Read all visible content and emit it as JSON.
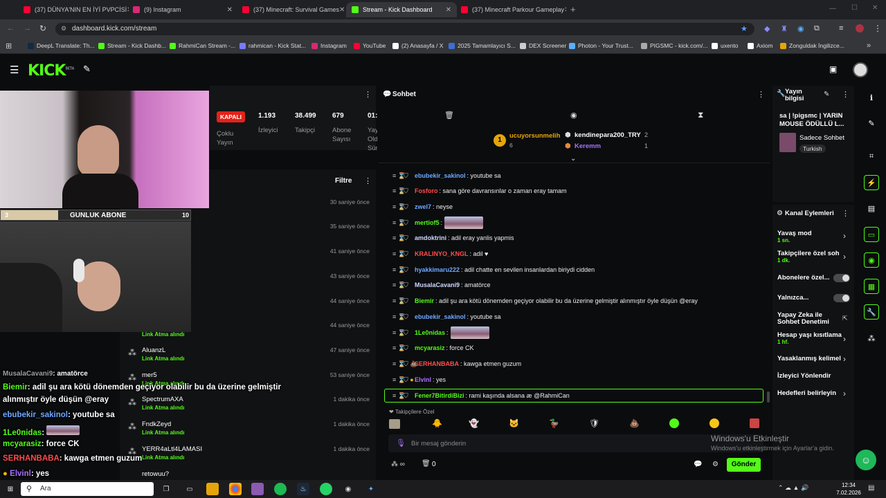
{
  "browser": {
    "tabs": [
      {
        "title": "(37) DÜNYA'NIN EN İYİ PVPCİSİ",
        "color": "#ff0033"
      },
      {
        "title": "(9) Instagram",
        "color": "#d62976"
      },
      {
        "title": "(37) Minecraft: Survival Games",
        "color": "#ff0033"
      },
      {
        "title": "Stream - Kick Dashboard",
        "color": "#53fc18"
      },
      {
        "title": "(37) Minecraft Parkour Gameplay",
        "color": "#ff0033"
      }
    ],
    "new_tab": "+",
    "url": "dashboard.kick.com/stream",
    "bookmarks": [
      {
        "label": "DeepL Translate: Th...",
        "color": "#0f2b46"
      },
      {
        "label": "Stream - Kick Dashb...",
        "color": "#53fc18"
      },
      {
        "label": "RahmiCan Stream -...",
        "color": "#53fc18"
      },
      {
        "label": "rahmican - Kick Stat...",
        "color": "#7a7aff"
      },
      {
        "label": "Instagram",
        "color": "#d62976"
      },
      {
        "label": "YouTube",
        "color": "#ff0033"
      },
      {
        "label": "(2) Anasayfa / X",
        "color": "#ffffff"
      },
      {
        "label": "2025 Tamamlayıcı S...",
        "color": "#3b6fd8"
      },
      {
        "label": "DEX Screener",
        "color": "#cccccc"
      },
      {
        "label": "Photon - Your Trust...",
        "color": "#5ab0ff"
      },
      {
        "label": "PIGSMC - kick.com/...",
        "color": "#aaaaaa"
      },
      {
        "label": "uxento",
        "color": "#ffffff"
      },
      {
        "label": "Axiom",
        "color": "#ffffff"
      },
      {
        "label": "Zonguldak İngilizce...",
        "color": "#e5a50a"
      }
    ]
  },
  "kick": {
    "logo": "KICK",
    "beta": "BETA"
  },
  "stats": {
    "status_badge": "KAPALI",
    "status_sub": "Çoklu Yayın",
    "viewers": {
      "value": "1.193",
      "label": "İzleyici"
    },
    "followers": {
      "value": "38.499",
      "label": "Takipçi"
    },
    "subscribers": {
      "value": "679",
      "label": "Abone Sayısı"
    },
    "duration": {
      "value": "01:",
      "label": "Yay Old Sür"
    }
  },
  "webcam": {
    "bar_left": "3",
    "bar_title": "GUNLUK ABONE",
    "bar_right": "10"
  },
  "activity": {
    "filter_label": "Filtre",
    "times": [
      "30 saniye önce",
      "35 saniye önce",
      "41 saniye önce",
      "43 saniye önce",
      "44 saniye önce",
      "44 saniye önce",
      "47 saniye önce",
      "53 saniye önce",
      "1 dakika önce",
      "1 dakika önce",
      "1 dakika önce"
    ],
    "followers": [
      {
        "name": "AluanzL",
        "action": "Link Atma alındı"
      },
      {
        "name": "mer5",
        "action": "Link Atma alındı"
      },
      {
        "name": "SpectrumAXA",
        "action": "Link Atma alındı"
      },
      {
        "name": "FndkZeyd",
        "action": "Link Atma alındı"
      },
      {
        "name": "YERR4aLtl4LAMASI",
        "action": "Link Atma alındı"
      },
      {
        "name": "retowuu?",
        "action": ""
      }
    ],
    "top_action": "Link Atma alındı"
  },
  "overlay_chat": [
    {
      "user": "MusalaCavani9",
      "text": ": amatörce",
      "color": "#9aa0a6"
    },
    {
      "user": "Biemir",
      "text": ": adil şu ara kötü dönemden geçiyor olabilir bu da üzerine gelmiştir",
      "color": "#53fc18"
    },
    {
      "user": "",
      "text": "alınmıştır öyle düşün @eray",
      "color": "#ffffff"
    },
    {
      "user": "ebubekir_sakinol",
      "text": ": youtube sa",
      "color": "#6ea8ff"
    },
    {
      "user": "1Le0nidas",
      "text": ":",
      "color": "#53fc18"
    },
    {
      "user": "mcyarasiz",
      "text": ": force CK",
      "color": "#53fc18"
    },
    {
      "user": "SERHANBABA",
      "text": ": kawga etmen guzum",
      "color": "#ff4d4d"
    },
    {
      "user": "Elvinl",
      "text": ": yes",
      "color": "#a970ff"
    }
  ],
  "chat": {
    "title": "Sohbet",
    "top_gifters": [
      {
        "name": "ucuyorsunmelih",
        "count": "6"
      },
      {
        "name": "kendinepara200_TRY",
        "count": "2"
      },
      {
        "name": "Keremm",
        "count": "1"
      }
    ],
    "messages": [
      {
        "user": "ebubekir_sakinol",
        "text": ": youtube sa",
        "color": "#6ea8ff"
      },
      {
        "user": "Fosforo",
        "text": ": sana göre davransınlar o zaman eray tamam",
        "color": "#ff4d4d"
      },
      {
        "user": "zwel7",
        "text": ": neyse",
        "color": "#6ea8ff"
      },
      {
        "user": "mertiof5",
        "text": ":",
        "color": "#53fc18",
        "emote": true
      },
      {
        "user": "amdoktrini",
        "text": ": adil eray yanlis yapmis",
        "color": "#cfd8ff"
      },
      {
        "user": "KRALINYO_KNGL",
        "text": ": adil ♥",
        "color": "#ff4d4d"
      },
      {
        "user": "hyakkimaru222",
        "text": ": adil chatte en sevilen insanlardan biriydi cidden",
        "color": "#6ea8ff"
      },
      {
        "user": "MusalaCavani9",
        "text": ": amatörce",
        "color": "#cfd8ff"
      },
      {
        "user": "Biemir",
        "text": ": adil şu ara kötü dönemden geçiyor olabilir bu da üzerine gelmiştir alınmıştır öyle düşün @eray",
        "color": "#53fc18"
      },
      {
        "user": "ebubekir_sakinol",
        "text": ": youtube sa",
        "color": "#6ea8ff"
      },
      {
        "user": "1Le0nidas",
        "text": ":",
        "color": "#53fc18",
        "emote": true
      },
      {
        "user": "mcyarasiz",
        "text": ": force CK",
        "color": "#53fc18"
      },
      {
        "user": "SERHANBABA",
        "text": ": kawga etmen guzum",
        "color": "#ff4d4d"
      },
      {
        "user": "Elvinl",
        "text": ": yes",
        "color": "#a970ff"
      },
      {
        "user": "Fener7BitirdiBizi",
        "text": ": rami kaşında alsana æ @RahmiCan",
        "color": "#53fc18"
      }
    ],
    "followers_only": "Takipçilere Özel",
    "input_placeholder": "Bir mesaj gönderin",
    "points_count": "0",
    "send_label": "Gönder"
  },
  "stream_info": {
    "title": "Yayın bilgisi",
    "stream_title": "sa | !pigsmc | YARIN MOUSE ÖDÜLLÜ L...",
    "category": "Sadece Sohbet",
    "language": "Turkish"
  },
  "channel_actions": {
    "title": "Kanal Eylemleri",
    "slow_mode": {
      "label": "Yavaş mod",
      "sub": "1 sn."
    },
    "followers_chat": {
      "label": "Takipçilere özel soh",
      "sub": "1 dk."
    },
    "subscribers": "Abonelere özel...",
    "emote_only": "Yalnızca...",
    "ai_moderation": "Yapay Zeka ile Sohbet Denetimi",
    "account_age": {
      "label": "Hesap yaşı kısıtlama",
      "sub": "1 hf."
    },
    "banned_words": "Yasaklanmış kelimel",
    "redirect": "İzleyici Yönlendir",
    "goals": "Hedefleri belirleyin"
  },
  "watermark": {
    "line1": "Windows'u Etkinleştir",
    "line2": "Windows'u etkinleştirmek için Ayarlar'a gidin."
  },
  "taskbar": {
    "search": "Ara",
    "time": "12:34",
    "date": "7.02.2026"
  }
}
